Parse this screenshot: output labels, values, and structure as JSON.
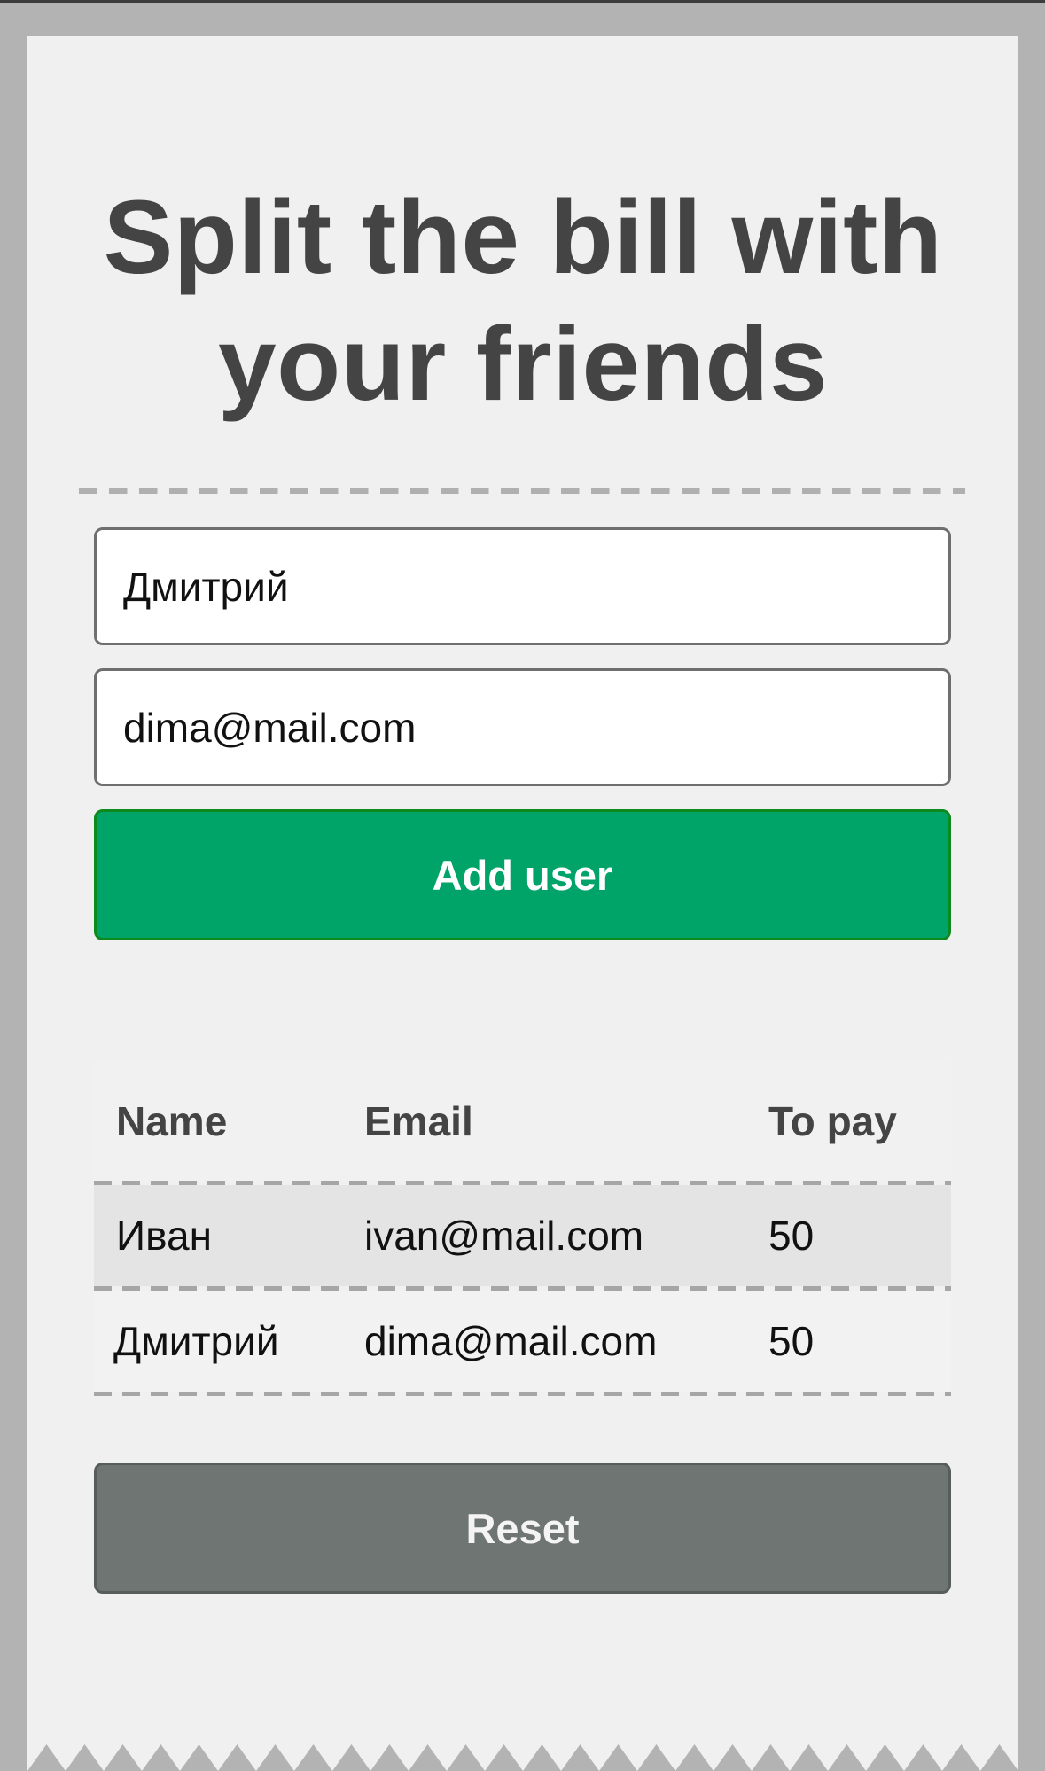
{
  "title": "Split the bill with your friends",
  "form": {
    "name_value": "Дмитрий",
    "email_value": "dima@mail.com",
    "add_label": "Add user"
  },
  "table": {
    "headers": [
      "Name",
      "Email",
      "To pay"
    ],
    "rows": [
      {
        "name": "Иван",
        "email": "ivan@mail.com",
        "to_pay": "50"
      },
      {
        "name": "Дмитрий",
        "email": "dima@mail.com",
        "to_pay": "50"
      }
    ]
  },
  "reset_label": "Reset",
  "colors": {
    "add_button": "#00a368",
    "reset_button": "#6e7573",
    "title_text": "#444444",
    "background": "#b3b3b3",
    "receipt": "#f0f0f0"
  }
}
